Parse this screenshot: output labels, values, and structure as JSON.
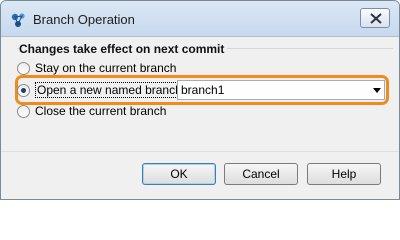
{
  "window": {
    "title": "Branch Operation"
  },
  "group": {
    "title": "Changes take effect on next commit"
  },
  "options": [
    {
      "label": "Stay on the current branch",
      "checked": false
    },
    {
      "label": "Open a new named branch",
      "checked": true
    },
    {
      "label": "Close the current branch",
      "checked": false
    }
  ],
  "branch_select": {
    "value": "branch1"
  },
  "buttons": {
    "ok": "OK",
    "cancel": "Cancel",
    "help": "Help"
  },
  "colors": {
    "highlight": "#f08c1e",
    "titlebar": "#c7d9ee"
  }
}
